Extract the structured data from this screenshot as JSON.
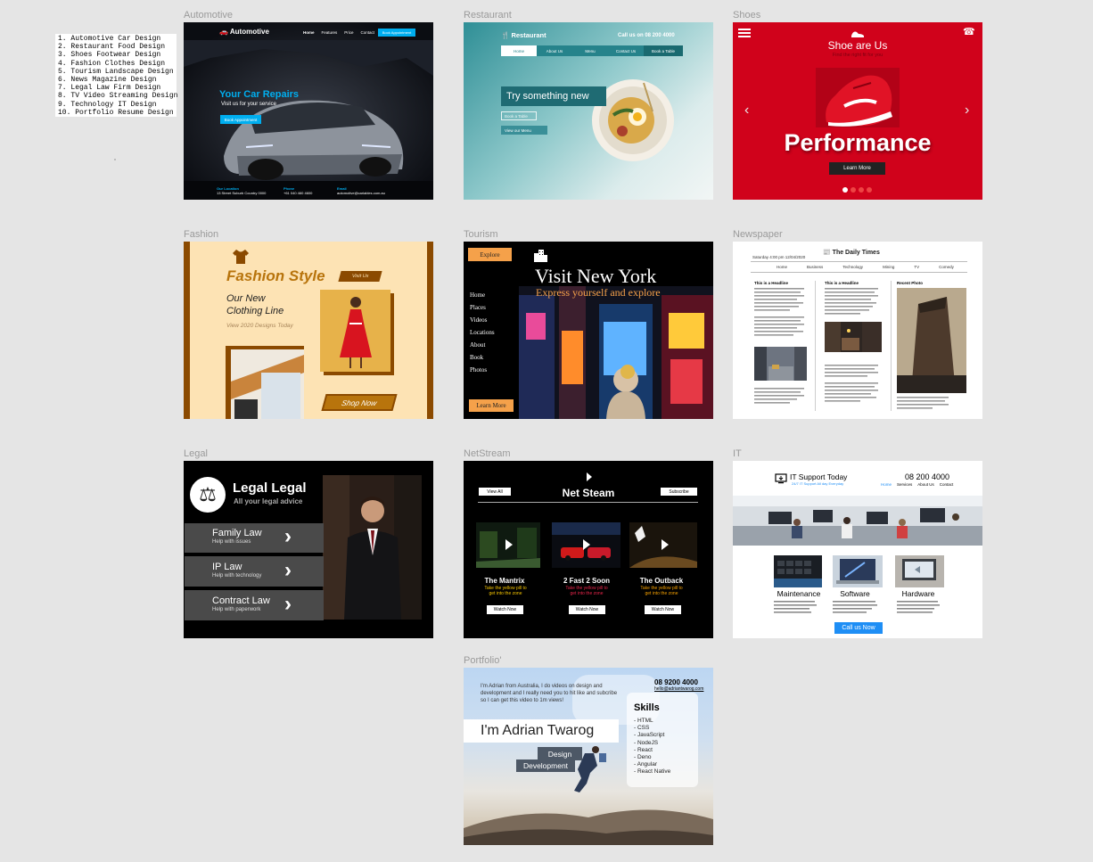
{
  "design_list": [
    "1. Automotive Car Design",
    "2. Restaurant Food Design",
    "3. Shoes Footwear Design",
    "4. Fashion Clothes Design",
    "5. Tourism Landscape Design",
    "6. News Magazine Design",
    "7. Legal Law Firm Design",
    "8. TV Video Streaming Design",
    "9. Technology IT Design",
    "10. Portfolio Resume Design"
  ],
  "frames": {
    "automotive": {
      "label": "Automotive",
      "brand": "Automotive",
      "nav": [
        "Home",
        "Features",
        "Price",
        "Contact"
      ],
      "cta": "Book Appointment",
      "headline": "Your Car Repairs",
      "subline": "Visit us for your service",
      "button": "Book Appointment",
      "footer": [
        {
          "title": "Our Location",
          "value": "13 Street Suburb Country 0000"
        },
        {
          "title": "Phone",
          "value": "+61 040 460 4600"
        },
        {
          "title": "Email",
          "value": "automotive@cariables.com.au"
        }
      ],
      "accent": "#00aeef"
    },
    "restaurant": {
      "label": "Restaurant",
      "brand": "Restaurant",
      "phone": "Call us on 08 200 4000",
      "nav": [
        "Home",
        "About Us",
        "Menu",
        "Contact Us",
        "Book a Table"
      ],
      "headline": "Try something new",
      "button1": "Book a Table",
      "button2": "View our Menu",
      "accent": "#1f6b73"
    },
    "shoes": {
      "label": "Shoes",
      "title": "Shoe are Us",
      "tagline": "Find the right fit for you",
      "hero": "Performance",
      "button": "Learn More",
      "accent": "#d0021b"
    },
    "fashion": {
      "label": "Fashion",
      "title": "Fashion Style",
      "visit": "Visit Us",
      "line1": "Our New",
      "line2": "Clothing Line",
      "subline": "View 2020 Designs Today",
      "button": "Shop Now",
      "accent": "#b8740c"
    },
    "tourism": {
      "label": "Tourism",
      "explore": "Explore",
      "title": "Visit New York",
      "subtitle": "Express yourself and explore",
      "menu": [
        "Home",
        "Places",
        "Videos",
        "Locations",
        "About",
        "Book",
        "Photos"
      ],
      "button": "Learn More",
      "accent": "#f5a14a"
    },
    "newspaper": {
      "label": "Newspaper",
      "masthead": "The Daily Times",
      "date": "Saturday 4:00 pm 12/04/2020",
      "nav": [
        "Home",
        "Business",
        "Technology",
        "Mining",
        "TV",
        "Comedy"
      ],
      "headline1": "This is a Headline",
      "headline2": "This is a Headline",
      "recent": "Recent Photo"
    },
    "legal": {
      "label": "Legal",
      "title": "Legal Legal",
      "subtitle": "All your legal advice",
      "items": [
        {
          "title": "Family Law",
          "sub": "Help with issues"
        },
        {
          "title": "IP Law",
          "sub": "Help with technology"
        },
        {
          "title": "Contract Law",
          "sub": "Help with paperwork"
        }
      ]
    },
    "netstream": {
      "label": "NetStream",
      "title": "Net Steam",
      "view_all": "View All",
      "subscribe": "Subscribe",
      "movies": [
        {
          "title": "The Mantrix",
          "tag": "Take the yellow pill to get into the zone",
          "button": "Watch Now"
        },
        {
          "title": "2 Fast 2 Soon",
          "tag": "Take the yellow pill to get into the zone",
          "button": "Watch Now"
        },
        {
          "title": "The Outback",
          "tag": "Take the yellow pill to get into the zone",
          "button": "Watch Now"
        }
      ],
      "accent": "#f5c400"
    },
    "it": {
      "label": "IT",
      "brand": "IT Support Today",
      "tagline": "24/7 IT Support All day Everyday",
      "phone": "08 200 4000",
      "nav": [
        "Home",
        "Services",
        "About Us",
        "Contact"
      ],
      "services": [
        "Maintenance",
        "Software",
        "Hardware"
      ],
      "button": "Call us Now",
      "accent": "#1e8ef5"
    },
    "portfolio": {
      "label": "Portfolio'",
      "intro": "I'm Adrian from Australia, I do videos on design and development and I really need you to hit like and subcribe so I can get this video to 1m views!",
      "phone": "08 9200 4000",
      "email": "hello@adriantwarog.com",
      "name": "I'm Adrian Twarog",
      "role1": "Design",
      "role2": "Development",
      "skills_title": "Skills",
      "skills": [
        "- HTML",
        "- CSS",
        "- JavaScript",
        "- NodeJS",
        "- React",
        "- Deno",
        "- Angular",
        "- React Native"
      ]
    }
  }
}
